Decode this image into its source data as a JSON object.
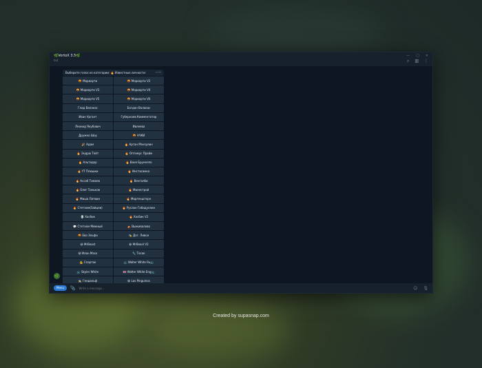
{
  "window": {
    "title": "🌿VortoX 3.5🌿",
    "subtitle": "bot",
    "controls": [
      "—",
      "▢",
      "✕"
    ],
    "toolbar_icons": [
      "search-icon",
      "sidebar-icon",
      "more-icon"
    ]
  },
  "message": {
    "text": "Выберите голос из категории: 🔥 Известные личности:",
    "time": "0:00"
  },
  "buttons": [
    "🤬 Мориарти",
    "🤬 Мориарти V2",
    "🤬 Мориарти V3",
    "🤬 Мориарти V4",
    "🤬 Мориарти V5",
    "🤬 Мориарти V6",
    "Глад Валакас",
    "Богдан Валакас",
    "Иван Ургант",
    "Губернаев Комментатор",
    "Леонид Якубович",
    "Ивлеева",
    "Дружко Шоу",
    "🤬 АЧКИ",
    "🎉 Адам",
    "🔥 Арган Мэнзулин",
    "🔥 Эндрю Тейт",
    "🔥 Оптимус Прайм",
    "🔥 Альтадор",
    "🔥 Ваня Брунелло",
    "🔥 YT Плюшки",
    "🔥 Инстасамка",
    "🔥 Ассаб Тимаев",
    "🔥 Венгалби",
    "🔥 Олег Тиньков",
    "🔥 Миллстрой",
    "🔥 Миша Литвин",
    "🔥 Моргенштерн",
    "🔥 Стетхем(Зайцев)",
    "🔥 Руслан Габидуллин",
    "💀 Хасбик",
    "🔥 Хасбик V2",
    "💬 Стетхем Мемный",
    "⛺ Выживалово",
    "🤬 Ева Эльфи",
    "🎭 Дог. Ливси",
    "😀 MrBeast",
    "😀 MrBeast V2",
    "😀 Илон Маск",
    "🔧 Тесак",
    "💪 Спартак",
    "📺 Walter White Ru📺",
    "📺 Skyler White",
    "🇬🇧 Walter White Eng📺",
    "🧙 Гендальф",
    "😀 Las Pinguinos"
  ],
  "input": {
    "menu_label": "Menu",
    "placeholder": "Write a message..."
  },
  "avatar_label": "🌿",
  "credit": "Created by supasnap.com"
}
